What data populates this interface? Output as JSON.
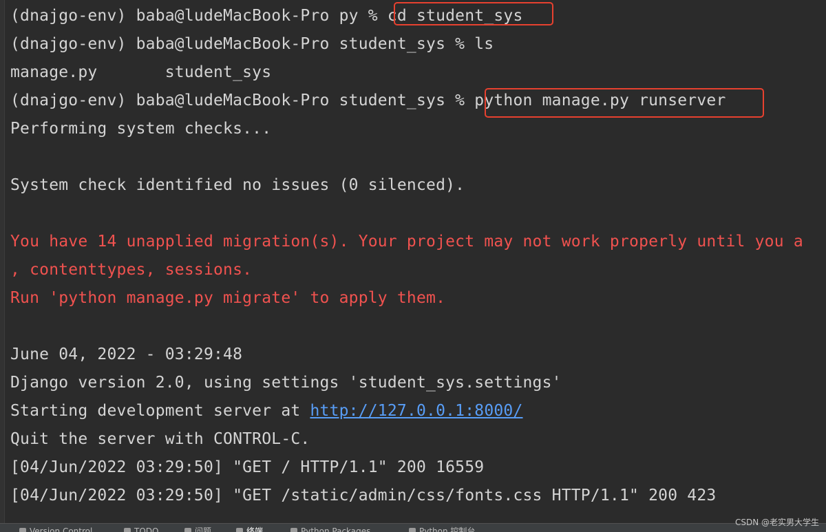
{
  "terminal": {
    "lines": [
      {
        "text": "(dnajgo-env) baba@ludeMacBook-Pro py % ",
        "cmd": "cd student_sys"
      },
      {
        "text": "(dnajgo-env) baba@ludeMacBook-Pro student_sys % ls"
      },
      {
        "text": "manage.py       student_sys"
      },
      {
        "text": "(dnajgo-env) baba@ludeMacBook-Pro student_sys % ",
        "cmd": "python manage.py runserver"
      },
      {
        "text": "Performing system checks..."
      },
      {
        "text": ""
      },
      {
        "text": "System check identified no issues (0 silenced)."
      },
      {
        "text": ""
      },
      {
        "text": "You have 14 unapplied migration(s). Your project may not work properly until you a",
        "style": "error"
      },
      {
        "text": ", contenttypes, sessions.",
        "style": "error"
      },
      {
        "text": "Run 'python manage.py migrate' to apply them.",
        "style": "error"
      },
      {
        "text": ""
      },
      {
        "text": "June 04, 2022 - 03:29:48"
      },
      {
        "text": "Django version 2.0, using settings 'student_sys.settings'"
      },
      {
        "text": "Starting development server at ",
        "link": "http://127.0.0.1:8000/"
      },
      {
        "text": "Quit the server with CONTROL-C."
      },
      {
        "text": "[04/Jun/2022 03:29:50] \"GET / HTTP/1.1\" 200 16559"
      },
      {
        "text": "[04/Jun/2022 03:29:50] \"GET /static/admin/css/fonts.css HTTP/1.1\" 200 423"
      }
    ]
  },
  "statusbar": {
    "tabs": [
      "Version Control",
      "TODO",
      "问题",
      "终端",
      "Python Packages",
      "Python 控制台"
    ],
    "active_tab": "终端"
  },
  "watermark": "CSDN @老实男大学生",
  "colors": {
    "background": "#2b2b2b",
    "text": "#d4d4d4",
    "error": "#f0524f",
    "link": "#589df6",
    "highlight_box": "#e8412f"
  }
}
